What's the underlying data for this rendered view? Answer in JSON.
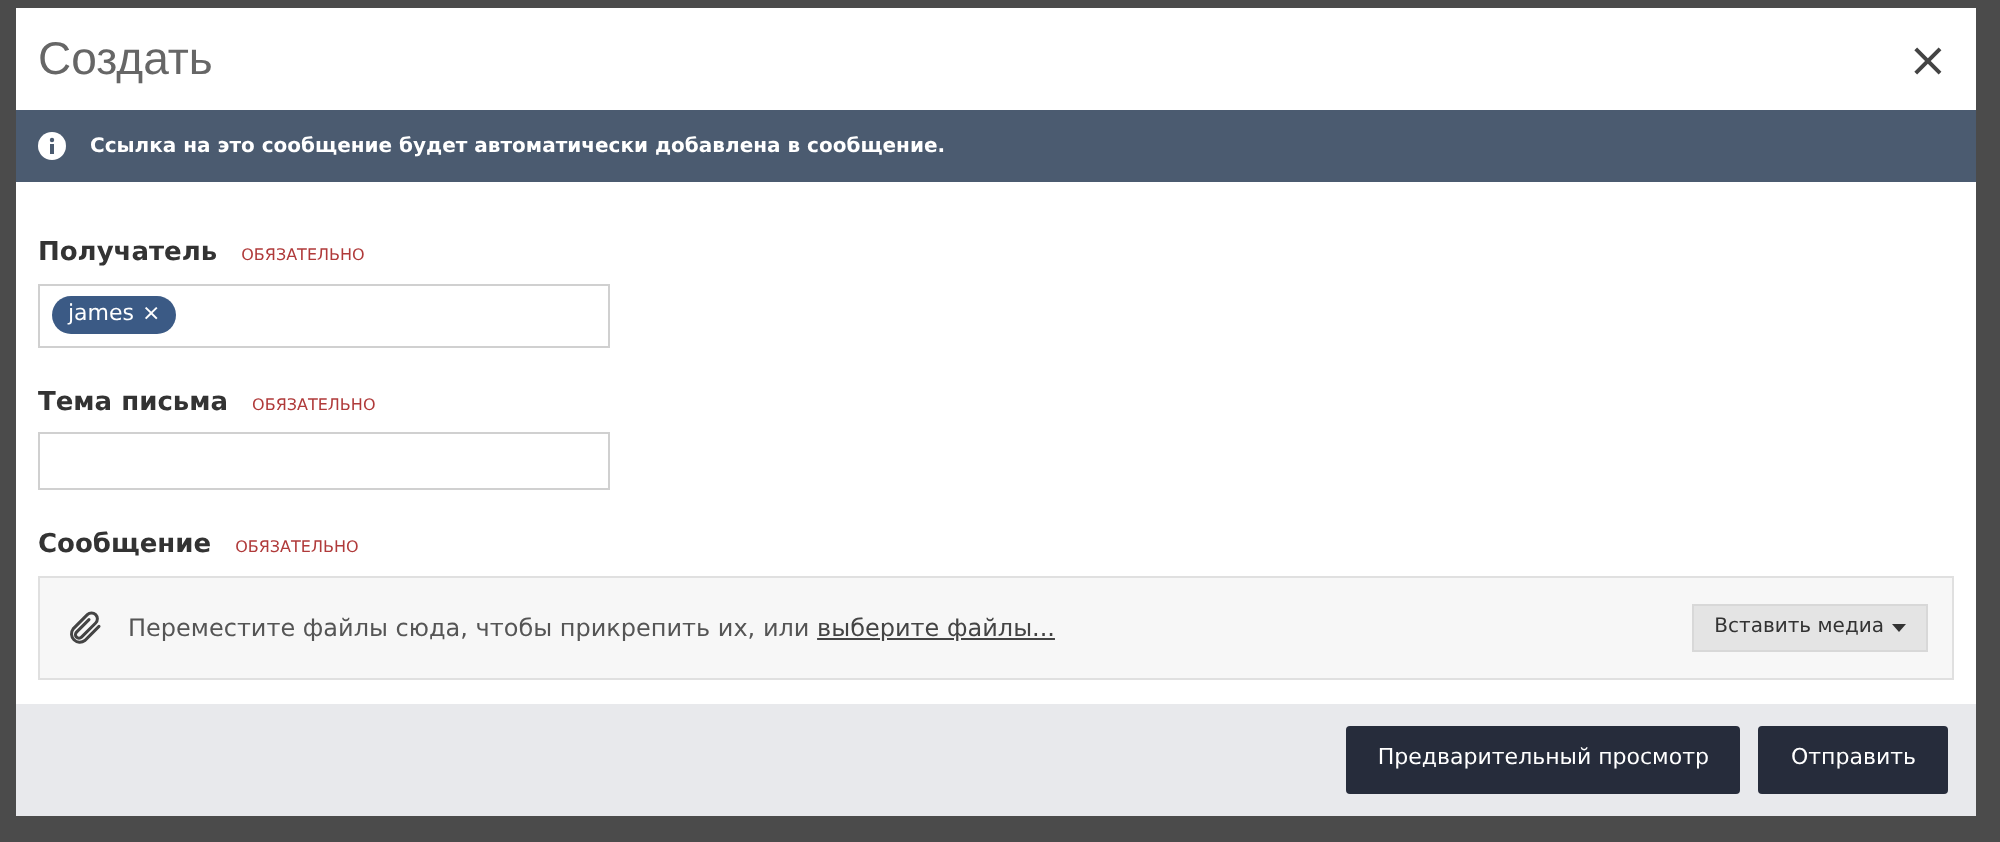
{
  "dialog": {
    "title": "Создать",
    "close": "×"
  },
  "notice": "Ссылка на это сообщение будет автоматически добавлена в сообщение.",
  "fields": [
    {
      "kind": "tags",
      "label": "Получатель",
      "required": "ОБЯЗАТЕЛЬНО",
      "tags": [
        {
          "text": "james",
          "remove": "×"
        }
      ]
    },
    {
      "kind": "text",
      "label": "Тема письма",
      "required": "ОБЯЗАТЕЛЬНО"
    },
    {
      "kind": "upload",
      "label": "Сообщение",
      "required": "ОБЯЗАТЕЛЬНО",
      "hint": "Переместите файлы сюда, чтобы прикрепить их, или",
      "link": "выберите файлы...",
      "media_button": "Вставить медиа"
    }
  ],
  "buttons": [
    {
      "label": "Предварительный просмотр"
    },
    {
      "label": "Отправить"
    }
  ]
}
